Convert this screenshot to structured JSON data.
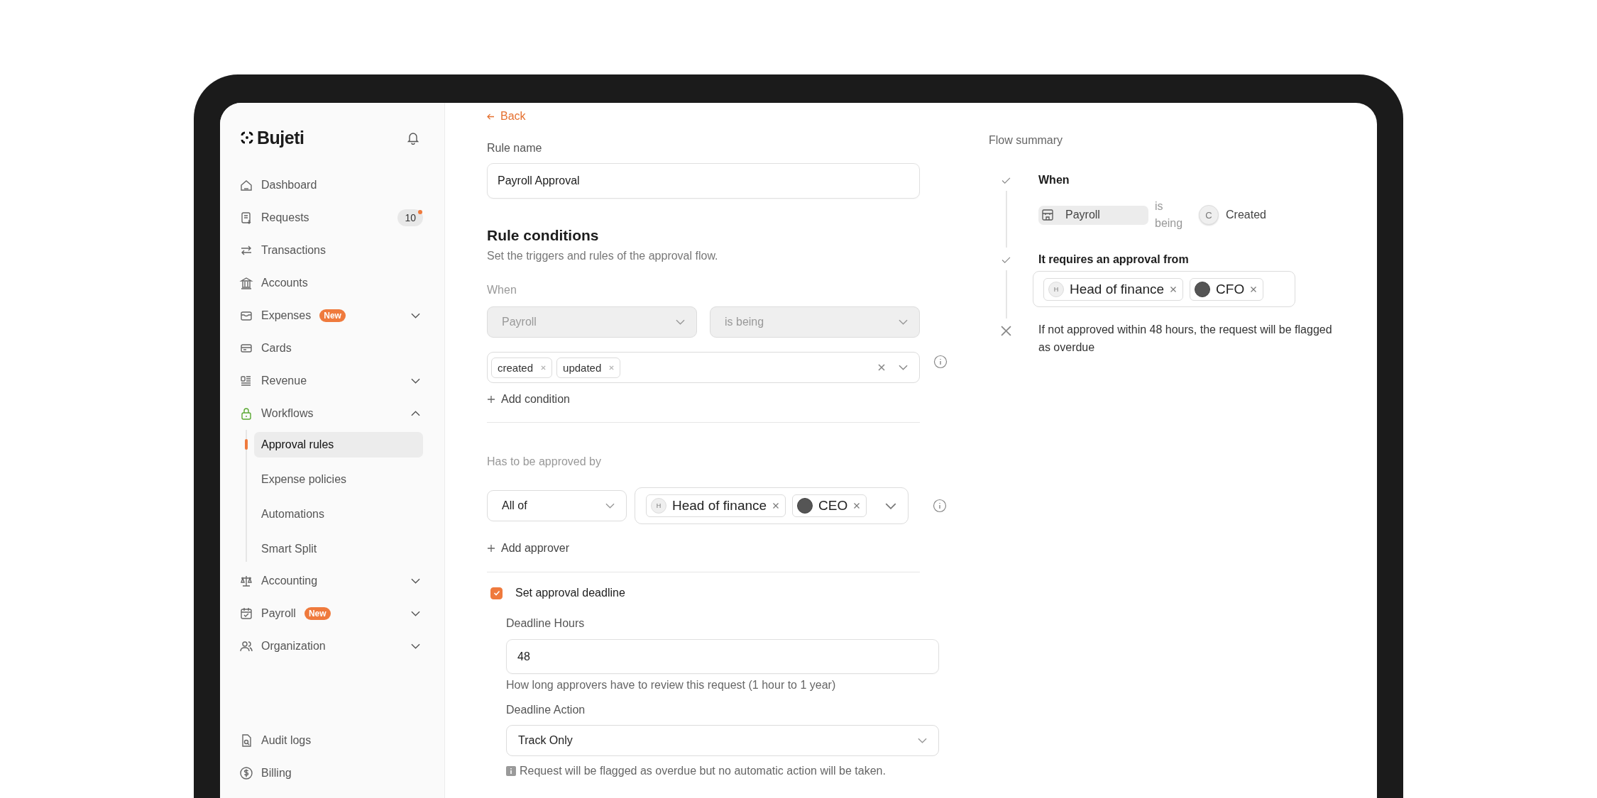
{
  "sidebar": {
    "logo": "Bujeti",
    "items": [
      {
        "label": "Dashboard",
        "selected": false
      },
      {
        "label": "Requests",
        "selected": false,
        "count": "10"
      },
      {
        "label": "Transactions",
        "selected": false
      },
      {
        "label": "Accounts",
        "selected": false
      },
      {
        "label": "Expenses",
        "selected": false,
        "badge": "New",
        "expanded": false
      },
      {
        "label": "Cards",
        "selected": false
      },
      {
        "label": "Revenue",
        "selected": false,
        "expanded": false
      },
      {
        "label": "Workflows",
        "selected": false,
        "expanded": true,
        "children": [
          {
            "label": "Approval rules",
            "selected": true
          },
          {
            "label": "Expense policies",
            "selected": false
          },
          {
            "label": "Automations",
            "selected": false
          },
          {
            "label": "Smart Split",
            "selected": false
          }
        ]
      },
      {
        "label": "Accounting",
        "selected": false,
        "expanded": false
      },
      {
        "label": "Payroll",
        "selected": false,
        "badge": "New",
        "expanded": false
      },
      {
        "label": "Organization",
        "selected": false,
        "expanded": false
      }
    ],
    "footer_items": [
      {
        "label": "Audit logs",
        "selected": false
      },
      {
        "label": "Billing",
        "selected": false
      }
    ]
  },
  "back": "Back",
  "rule_name": {
    "label": "Rule name",
    "value": "Payroll Approval"
  },
  "conditions": {
    "title": "Rule conditions",
    "subtitle": "Set the triggers and rules of the approval flow.",
    "when_label": "When",
    "subject": {
      "value": "Payroll",
      "disabled": true
    },
    "operator": {
      "value": "is being",
      "disabled": true
    },
    "actions": [
      {
        "label": "created"
      },
      {
        "label": "updated"
      }
    ],
    "add_label": "Add condition"
  },
  "approval": {
    "label": "Has to be approved by",
    "mode": "All of",
    "approvers": [
      {
        "name": "Head of finance",
        "kind": "initial",
        "initial": "H"
      },
      {
        "name": "CEO",
        "kind": "photo"
      }
    ],
    "add_label": "Add approver"
  },
  "deadline": {
    "checked": true,
    "label": "Set approval deadline",
    "hours_label": "Deadline Hours",
    "hours_value": "48",
    "hours_help": "How long approvers have to review this request (1 hour to 1 year)",
    "action_label": "Deadline Action",
    "action_value": "Track Only",
    "note": "Request will be flagged as overdue but no automatic action will be taken."
  },
  "summary": {
    "title": "Flow summary",
    "steps": [
      {
        "kind": "when",
        "done": true,
        "title": "When",
        "subject": "Payroll",
        "operator": "is being",
        "action_initial": "C",
        "action": "Created"
      },
      {
        "kind": "approvers",
        "done": true,
        "title": "It requires an approval from",
        "approvers": [
          {
            "name": "Head of finance",
            "kind": "initial",
            "initial": "H"
          },
          {
            "name": "CFO",
            "kind": "photo"
          }
        ]
      },
      {
        "kind": "deadline",
        "done": false,
        "text": "If not approved within 48 hours, the request will be flagged as overdue"
      }
    ]
  }
}
